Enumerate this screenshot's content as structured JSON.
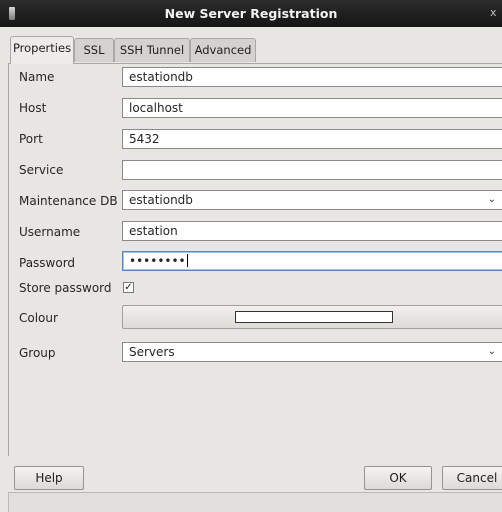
{
  "window": {
    "title": "New Server Registration",
    "close_glyph": "x",
    "icon": "app-icon"
  },
  "tabs": [
    {
      "label": "Properties",
      "active": true
    },
    {
      "label": "SSL",
      "active": false
    },
    {
      "label": "SSH Tunnel",
      "active": false
    },
    {
      "label": "Advanced",
      "active": false
    }
  ],
  "form": {
    "name": {
      "label": "Name",
      "value": "estationdb"
    },
    "host": {
      "label": "Host",
      "value": "localhost"
    },
    "port": {
      "label": "Port",
      "value": "5432"
    },
    "service": {
      "label": "Service",
      "value": ""
    },
    "maintenance_db": {
      "label": "Maintenance DB",
      "value": "estationdb",
      "icon": "chevron-down-icon"
    },
    "username": {
      "label": "Username",
      "value": "estation"
    },
    "password": {
      "label": "Password",
      "value": "••••••••",
      "focused": true
    },
    "store_password": {
      "label": "Store password",
      "checked": true,
      "check_glyph": "☑"
    },
    "colour": {
      "label": "Colour",
      "value": "#ffffff"
    },
    "group": {
      "label": "Group",
      "value": "Servers",
      "icon": "chevron-down-icon"
    }
  },
  "buttons": {
    "help": "Help",
    "ok": "OK",
    "cancel": "Cancel"
  },
  "icons": {
    "chevron": "⌄"
  }
}
